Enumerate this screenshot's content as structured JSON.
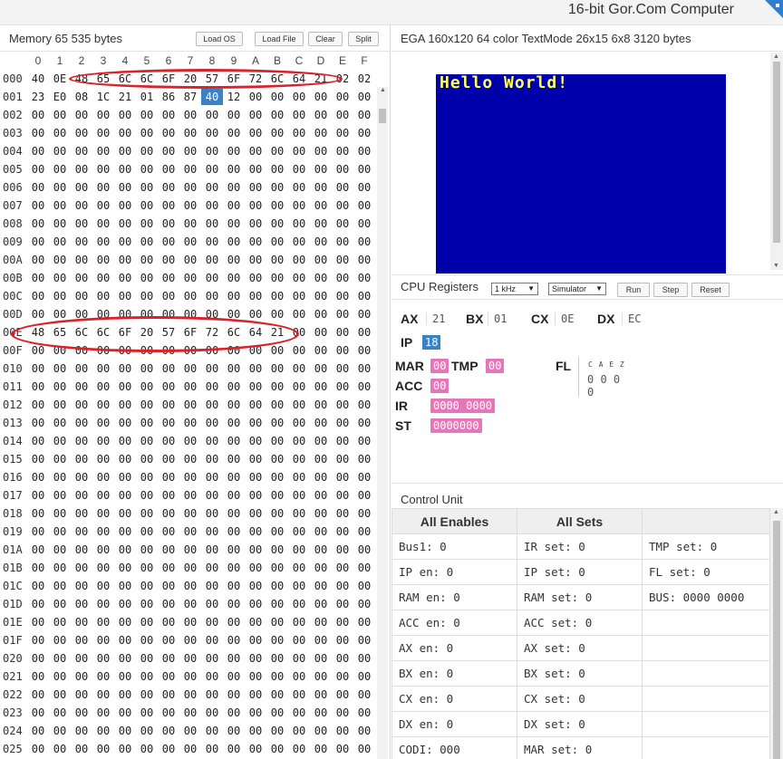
{
  "app_title": "16-bit Gor.Com Computer",
  "memory": {
    "title": "Memory 65 535 bytes",
    "buttons": {
      "load_os": "Load OS",
      "load_file": "Load File",
      "clear": "Clear",
      "split": "Split"
    },
    "columns": [
      "0",
      "1",
      "2",
      "3",
      "4",
      "5",
      "6",
      "7",
      "8",
      "9",
      "A",
      "B",
      "C",
      "D",
      "E",
      "F"
    ],
    "rows": [
      {
        "addr": "000",
        "cells": [
          "40",
          "0E",
          "48",
          "65",
          "6C",
          "6C",
          "6F",
          "20",
          "57",
          "6F",
          "72",
          "6C",
          "64",
          "21",
          "02",
          "02"
        ]
      },
      {
        "addr": "001",
        "cells": [
          "23",
          "E0",
          "08",
          "1C",
          "21",
          "01",
          "86",
          "87",
          "40",
          "12",
          "00",
          "00",
          "00",
          "00",
          "00",
          "00"
        ]
      },
      {
        "addr": "002",
        "cells": [
          "00",
          "00",
          "00",
          "00",
          "00",
          "00",
          "00",
          "00",
          "00",
          "00",
          "00",
          "00",
          "00",
          "00",
          "00",
          "00"
        ]
      },
      {
        "addr": "003",
        "cells": [
          "00",
          "00",
          "00",
          "00",
          "00",
          "00",
          "00",
          "00",
          "00",
          "00",
          "00",
          "00",
          "00",
          "00",
          "00",
          "00"
        ]
      },
      {
        "addr": "004",
        "cells": [
          "00",
          "00",
          "00",
          "00",
          "00",
          "00",
          "00",
          "00",
          "00",
          "00",
          "00",
          "00",
          "00",
          "00",
          "00",
          "00"
        ]
      },
      {
        "addr": "005",
        "cells": [
          "00",
          "00",
          "00",
          "00",
          "00",
          "00",
          "00",
          "00",
          "00",
          "00",
          "00",
          "00",
          "00",
          "00",
          "00",
          "00"
        ]
      },
      {
        "addr": "006",
        "cells": [
          "00",
          "00",
          "00",
          "00",
          "00",
          "00",
          "00",
          "00",
          "00",
          "00",
          "00",
          "00",
          "00",
          "00",
          "00",
          "00"
        ]
      },
      {
        "addr": "007",
        "cells": [
          "00",
          "00",
          "00",
          "00",
          "00",
          "00",
          "00",
          "00",
          "00",
          "00",
          "00",
          "00",
          "00",
          "00",
          "00",
          "00"
        ]
      },
      {
        "addr": "008",
        "cells": [
          "00",
          "00",
          "00",
          "00",
          "00",
          "00",
          "00",
          "00",
          "00",
          "00",
          "00",
          "00",
          "00",
          "00",
          "00",
          "00"
        ]
      },
      {
        "addr": "009",
        "cells": [
          "00",
          "00",
          "00",
          "00",
          "00",
          "00",
          "00",
          "00",
          "00",
          "00",
          "00",
          "00",
          "00",
          "00",
          "00",
          "00"
        ]
      },
      {
        "addr": "00A",
        "cells": [
          "00",
          "00",
          "00",
          "00",
          "00",
          "00",
          "00",
          "00",
          "00",
          "00",
          "00",
          "00",
          "00",
          "00",
          "00",
          "00"
        ]
      },
      {
        "addr": "00B",
        "cells": [
          "00",
          "00",
          "00",
          "00",
          "00",
          "00",
          "00",
          "00",
          "00",
          "00",
          "00",
          "00",
          "00",
          "00",
          "00",
          "00"
        ]
      },
      {
        "addr": "00C",
        "cells": [
          "00",
          "00",
          "00",
          "00",
          "00",
          "00",
          "00",
          "00",
          "00",
          "00",
          "00",
          "00",
          "00",
          "00",
          "00",
          "00"
        ]
      },
      {
        "addr": "00D",
        "cells": [
          "00",
          "00",
          "00",
          "00",
          "00",
          "00",
          "00",
          "00",
          "00",
          "00",
          "00",
          "00",
          "00",
          "00",
          "00",
          "00"
        ]
      },
      {
        "addr": "00E",
        "cells": [
          "48",
          "65",
          "6C",
          "6C",
          "6F",
          "20",
          "57",
          "6F",
          "72",
          "6C",
          "64",
          "21",
          "00",
          "00",
          "00",
          "00"
        ]
      },
      {
        "addr": "00F",
        "cells": [
          "00",
          "00",
          "00",
          "00",
          "00",
          "00",
          "00",
          "00",
          "00",
          "00",
          "00",
          "00",
          "00",
          "00",
          "00",
          "00"
        ]
      },
      {
        "addr": "010",
        "cells": [
          "00",
          "00",
          "00",
          "00",
          "00",
          "00",
          "00",
          "00",
          "00",
          "00",
          "00",
          "00",
          "00",
          "00",
          "00",
          "00"
        ]
      },
      {
        "addr": "011",
        "cells": [
          "00",
          "00",
          "00",
          "00",
          "00",
          "00",
          "00",
          "00",
          "00",
          "00",
          "00",
          "00",
          "00",
          "00",
          "00",
          "00"
        ]
      },
      {
        "addr": "012",
        "cells": [
          "00",
          "00",
          "00",
          "00",
          "00",
          "00",
          "00",
          "00",
          "00",
          "00",
          "00",
          "00",
          "00",
          "00",
          "00",
          "00"
        ]
      },
      {
        "addr": "013",
        "cells": [
          "00",
          "00",
          "00",
          "00",
          "00",
          "00",
          "00",
          "00",
          "00",
          "00",
          "00",
          "00",
          "00",
          "00",
          "00",
          "00"
        ]
      },
      {
        "addr": "014",
        "cells": [
          "00",
          "00",
          "00",
          "00",
          "00",
          "00",
          "00",
          "00",
          "00",
          "00",
          "00",
          "00",
          "00",
          "00",
          "00",
          "00"
        ]
      },
      {
        "addr": "015",
        "cells": [
          "00",
          "00",
          "00",
          "00",
          "00",
          "00",
          "00",
          "00",
          "00",
          "00",
          "00",
          "00",
          "00",
          "00",
          "00",
          "00"
        ]
      },
      {
        "addr": "016",
        "cells": [
          "00",
          "00",
          "00",
          "00",
          "00",
          "00",
          "00",
          "00",
          "00",
          "00",
          "00",
          "00",
          "00",
          "00",
          "00",
          "00"
        ]
      },
      {
        "addr": "017",
        "cells": [
          "00",
          "00",
          "00",
          "00",
          "00",
          "00",
          "00",
          "00",
          "00",
          "00",
          "00",
          "00",
          "00",
          "00",
          "00",
          "00"
        ]
      },
      {
        "addr": "018",
        "cells": [
          "00",
          "00",
          "00",
          "00",
          "00",
          "00",
          "00",
          "00",
          "00",
          "00",
          "00",
          "00",
          "00",
          "00",
          "00",
          "00"
        ]
      },
      {
        "addr": "019",
        "cells": [
          "00",
          "00",
          "00",
          "00",
          "00",
          "00",
          "00",
          "00",
          "00",
          "00",
          "00",
          "00",
          "00",
          "00",
          "00",
          "00"
        ]
      },
      {
        "addr": "01A",
        "cells": [
          "00",
          "00",
          "00",
          "00",
          "00",
          "00",
          "00",
          "00",
          "00",
          "00",
          "00",
          "00",
          "00",
          "00",
          "00",
          "00"
        ]
      },
      {
        "addr": "01B",
        "cells": [
          "00",
          "00",
          "00",
          "00",
          "00",
          "00",
          "00",
          "00",
          "00",
          "00",
          "00",
          "00",
          "00",
          "00",
          "00",
          "00"
        ]
      },
      {
        "addr": "01C",
        "cells": [
          "00",
          "00",
          "00",
          "00",
          "00",
          "00",
          "00",
          "00",
          "00",
          "00",
          "00",
          "00",
          "00",
          "00",
          "00",
          "00"
        ]
      },
      {
        "addr": "01D",
        "cells": [
          "00",
          "00",
          "00",
          "00",
          "00",
          "00",
          "00",
          "00",
          "00",
          "00",
          "00",
          "00",
          "00",
          "00",
          "00",
          "00"
        ]
      },
      {
        "addr": "01E",
        "cells": [
          "00",
          "00",
          "00",
          "00",
          "00",
          "00",
          "00",
          "00",
          "00",
          "00",
          "00",
          "00",
          "00",
          "00",
          "00",
          "00"
        ]
      },
      {
        "addr": "01F",
        "cells": [
          "00",
          "00",
          "00",
          "00",
          "00",
          "00",
          "00",
          "00",
          "00",
          "00",
          "00",
          "00",
          "00",
          "00",
          "00",
          "00"
        ]
      },
      {
        "addr": "020",
        "cells": [
          "00",
          "00",
          "00",
          "00",
          "00",
          "00",
          "00",
          "00",
          "00",
          "00",
          "00",
          "00",
          "00",
          "00",
          "00",
          "00"
        ]
      },
      {
        "addr": "021",
        "cells": [
          "00",
          "00",
          "00",
          "00",
          "00",
          "00",
          "00",
          "00",
          "00",
          "00",
          "00",
          "00",
          "00",
          "00",
          "00",
          "00"
        ]
      },
      {
        "addr": "022",
        "cells": [
          "00",
          "00",
          "00",
          "00",
          "00",
          "00",
          "00",
          "00",
          "00",
          "00",
          "00",
          "00",
          "00",
          "00",
          "00",
          "00"
        ]
      },
      {
        "addr": "023",
        "cells": [
          "00",
          "00",
          "00",
          "00",
          "00",
          "00",
          "00",
          "00",
          "00",
          "00",
          "00",
          "00",
          "00",
          "00",
          "00",
          "00"
        ]
      },
      {
        "addr": "024",
        "cells": [
          "00",
          "00",
          "00",
          "00",
          "00",
          "00",
          "00",
          "00",
          "00",
          "00",
          "00",
          "00",
          "00",
          "00",
          "00",
          "00"
        ]
      },
      {
        "addr": "025",
        "cells": [
          "00",
          "00",
          "00",
          "00",
          "00",
          "00",
          "00",
          "00",
          "00",
          "00",
          "00",
          "00",
          "00",
          "00",
          "00",
          "00"
        ]
      }
    ],
    "highlight_color": "#3b82c4"
  },
  "ega": {
    "title": "EGA 160x120 64 color TextMode 26x15 6x8 3120 bytes",
    "screen_text": "Hello World!",
    "bg_color": "#0000aa",
    "text_color": "#ffff55"
  },
  "cpu": {
    "title": "CPU Registers",
    "clock_option": "1 kHz",
    "mode_option": "Simulator",
    "buttons": {
      "run": "Run",
      "step": "Step",
      "reset": "Reset"
    },
    "registers": {
      "AX": "21",
      "BX": "01",
      "CX": "0E",
      "DX": "EC",
      "IP": "18",
      "MAR": "00",
      "TMP": "00",
      "ACC": "00",
      "IR": "0000 0000",
      "ST": "0000000"
    },
    "labels": {
      "ax": "AX",
      "bx": "BX",
      "cx": "CX",
      "dx": "DX",
      "ip": "IP",
      "mar": "MAR",
      "tmp": "TMP",
      "acc": "ACC",
      "ir": "IR",
      "st": "ST",
      "fl": "FL"
    },
    "flags": {
      "names": "C A E Z",
      "values": "0 0 0 0"
    },
    "pink_color": "#e577b8"
  },
  "control_unit": {
    "title": "Control Unit",
    "headers": [
      "All Enables",
      "All Sets",
      ""
    ],
    "rows": [
      [
        "Bus1: 0",
        "IR set: 0",
        "TMP set: 0"
      ],
      [
        "IP en: 0",
        "IP set: 0",
        "FL set: 0"
      ],
      [
        "RAM en: 0",
        "RAM set: 0",
        "BUS: 0000 0000"
      ],
      [
        "ACC en: 0",
        "ACC set: 0",
        ""
      ],
      [
        "AX en: 0",
        "AX set: 0",
        ""
      ],
      [
        "BX en: 0",
        "BX set: 0",
        ""
      ],
      [
        "CX en: 0",
        "CX set: 0",
        ""
      ],
      [
        "DX en: 0",
        "DX set: 0",
        ""
      ],
      [
        "CODI: 000",
        "MAR set: 0",
        ""
      ]
    ]
  }
}
